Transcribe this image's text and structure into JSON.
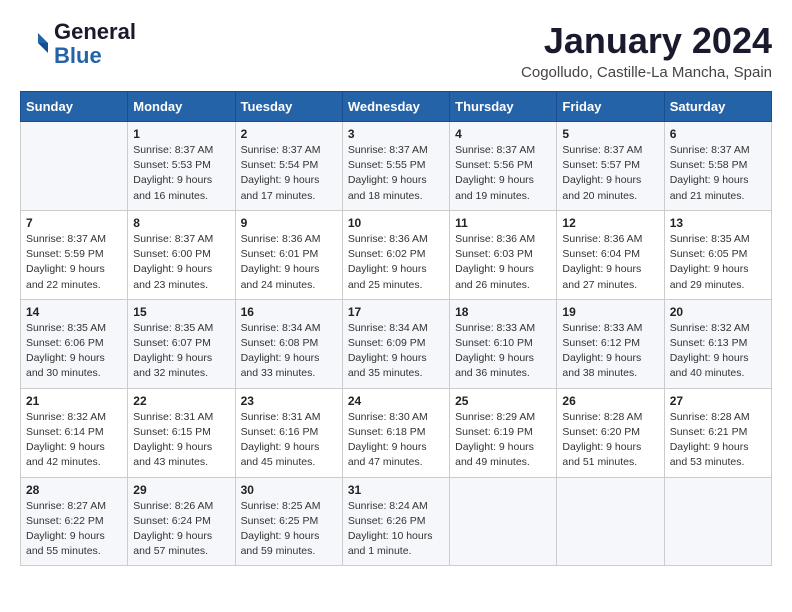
{
  "logo": {
    "line1": "General",
    "line2": "Blue"
  },
  "title": "January 2024",
  "subtitle": "Cogolludo, Castille-La Mancha, Spain",
  "headers": [
    "Sunday",
    "Monday",
    "Tuesday",
    "Wednesday",
    "Thursday",
    "Friday",
    "Saturday"
  ],
  "weeks": [
    [
      {
        "day": "",
        "content": ""
      },
      {
        "day": "1",
        "content": "Sunrise: 8:37 AM\nSunset: 5:53 PM\nDaylight: 9 hours\nand 16 minutes."
      },
      {
        "day": "2",
        "content": "Sunrise: 8:37 AM\nSunset: 5:54 PM\nDaylight: 9 hours\nand 17 minutes."
      },
      {
        "day": "3",
        "content": "Sunrise: 8:37 AM\nSunset: 5:55 PM\nDaylight: 9 hours\nand 18 minutes."
      },
      {
        "day": "4",
        "content": "Sunrise: 8:37 AM\nSunset: 5:56 PM\nDaylight: 9 hours\nand 19 minutes."
      },
      {
        "day": "5",
        "content": "Sunrise: 8:37 AM\nSunset: 5:57 PM\nDaylight: 9 hours\nand 20 minutes."
      },
      {
        "day": "6",
        "content": "Sunrise: 8:37 AM\nSunset: 5:58 PM\nDaylight: 9 hours\nand 21 minutes."
      }
    ],
    [
      {
        "day": "7",
        "content": "Sunrise: 8:37 AM\nSunset: 5:59 PM\nDaylight: 9 hours\nand 22 minutes."
      },
      {
        "day": "8",
        "content": "Sunrise: 8:37 AM\nSunset: 6:00 PM\nDaylight: 9 hours\nand 23 minutes."
      },
      {
        "day": "9",
        "content": "Sunrise: 8:36 AM\nSunset: 6:01 PM\nDaylight: 9 hours\nand 24 minutes."
      },
      {
        "day": "10",
        "content": "Sunrise: 8:36 AM\nSunset: 6:02 PM\nDaylight: 9 hours\nand 25 minutes."
      },
      {
        "day": "11",
        "content": "Sunrise: 8:36 AM\nSunset: 6:03 PM\nDaylight: 9 hours\nand 26 minutes."
      },
      {
        "day": "12",
        "content": "Sunrise: 8:36 AM\nSunset: 6:04 PM\nDaylight: 9 hours\nand 27 minutes."
      },
      {
        "day": "13",
        "content": "Sunrise: 8:35 AM\nSunset: 6:05 PM\nDaylight: 9 hours\nand 29 minutes."
      }
    ],
    [
      {
        "day": "14",
        "content": "Sunrise: 8:35 AM\nSunset: 6:06 PM\nDaylight: 9 hours\nand 30 minutes."
      },
      {
        "day": "15",
        "content": "Sunrise: 8:35 AM\nSunset: 6:07 PM\nDaylight: 9 hours\nand 32 minutes."
      },
      {
        "day": "16",
        "content": "Sunrise: 8:34 AM\nSunset: 6:08 PM\nDaylight: 9 hours\nand 33 minutes."
      },
      {
        "day": "17",
        "content": "Sunrise: 8:34 AM\nSunset: 6:09 PM\nDaylight: 9 hours\nand 35 minutes."
      },
      {
        "day": "18",
        "content": "Sunrise: 8:33 AM\nSunset: 6:10 PM\nDaylight: 9 hours\nand 36 minutes."
      },
      {
        "day": "19",
        "content": "Sunrise: 8:33 AM\nSunset: 6:12 PM\nDaylight: 9 hours\nand 38 minutes."
      },
      {
        "day": "20",
        "content": "Sunrise: 8:32 AM\nSunset: 6:13 PM\nDaylight: 9 hours\nand 40 minutes."
      }
    ],
    [
      {
        "day": "21",
        "content": "Sunrise: 8:32 AM\nSunset: 6:14 PM\nDaylight: 9 hours\nand 42 minutes."
      },
      {
        "day": "22",
        "content": "Sunrise: 8:31 AM\nSunset: 6:15 PM\nDaylight: 9 hours\nand 43 minutes."
      },
      {
        "day": "23",
        "content": "Sunrise: 8:31 AM\nSunset: 6:16 PM\nDaylight: 9 hours\nand 45 minutes."
      },
      {
        "day": "24",
        "content": "Sunrise: 8:30 AM\nSunset: 6:18 PM\nDaylight: 9 hours\nand 47 minutes."
      },
      {
        "day": "25",
        "content": "Sunrise: 8:29 AM\nSunset: 6:19 PM\nDaylight: 9 hours\nand 49 minutes."
      },
      {
        "day": "26",
        "content": "Sunrise: 8:28 AM\nSunset: 6:20 PM\nDaylight: 9 hours\nand 51 minutes."
      },
      {
        "day": "27",
        "content": "Sunrise: 8:28 AM\nSunset: 6:21 PM\nDaylight: 9 hours\nand 53 minutes."
      }
    ],
    [
      {
        "day": "28",
        "content": "Sunrise: 8:27 AM\nSunset: 6:22 PM\nDaylight: 9 hours\nand 55 minutes."
      },
      {
        "day": "29",
        "content": "Sunrise: 8:26 AM\nSunset: 6:24 PM\nDaylight: 9 hours\nand 57 minutes."
      },
      {
        "day": "30",
        "content": "Sunrise: 8:25 AM\nSunset: 6:25 PM\nDaylight: 9 hours\nand 59 minutes."
      },
      {
        "day": "31",
        "content": "Sunrise: 8:24 AM\nSunset: 6:26 PM\nDaylight: 10 hours\nand 1 minute."
      },
      {
        "day": "",
        "content": ""
      },
      {
        "day": "",
        "content": ""
      },
      {
        "day": "",
        "content": ""
      }
    ]
  ]
}
